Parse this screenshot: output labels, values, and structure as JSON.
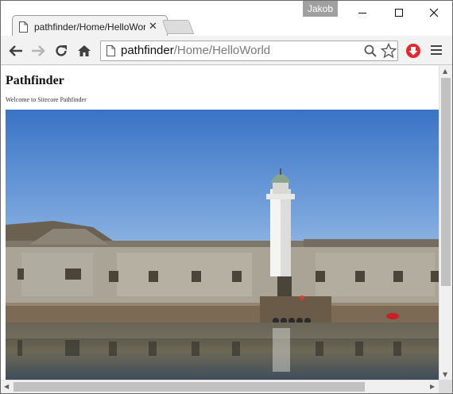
{
  "browser": {
    "profile_name": "Jakob",
    "tab": {
      "title": "pathfinder/Home/HelloWorld",
      "close_label": "✕"
    },
    "omnibox": {
      "host": "pathfinder",
      "path": "/Home/HelloWorld"
    },
    "icons": [
      "back-arrow-icon",
      "forward-arrow-icon",
      "reload-icon",
      "home-icon",
      "search-icon",
      "star-icon",
      "extension-icon",
      "menu-icon"
    ],
    "colors": {
      "extension_red": "#e8262e",
      "scroll_thumb": "#c1c1c1"
    }
  },
  "page": {
    "heading": "Pathfinder",
    "subtitle": "Welcome to Sitecore Pathfinder",
    "hero_image": "lighthouse-fortress-photo"
  }
}
